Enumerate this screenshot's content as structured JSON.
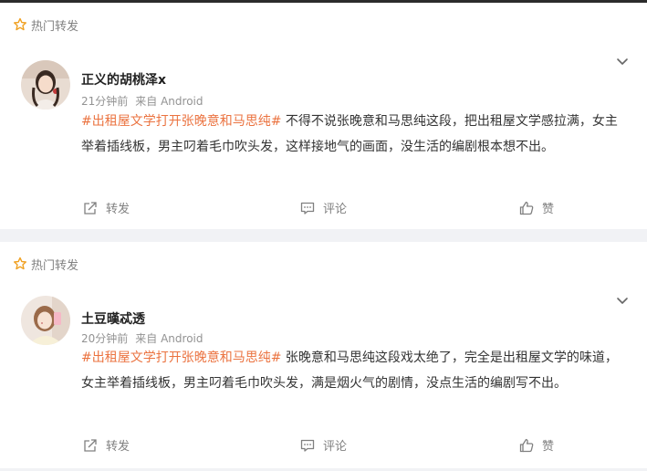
{
  "posts": [
    {
      "hot_label": "热门转发",
      "username": "正义的胡桃泽x",
      "time": "21分钟前",
      "source": "来自 Android",
      "hashtag": "#出租屋文学打开张晚意和马思纯#",
      "text": " 不得不说张晚意和马思纯这段，把出租屋文学感拉满，女主举着插线板，男主叼着毛巾吹头发，这样接地气的画面，没生活的编剧根本想不出。",
      "actions": {
        "forward": "转发",
        "comment": "评论",
        "like": "赞"
      }
    },
    {
      "hot_label": "热门转发",
      "username": "土豆暵忒透",
      "time": "20分钟前",
      "source": "来自 Android",
      "hashtag": "#出租屋文学打开张晚意和马思纯#",
      "text": " 张晚意和马思纯这段戏太绝了，完全是出租屋文学的味道，女主举着插线板，男主叼着毛巾吹头发，满是烟火气的剧情，没点生活的编剧写不出。",
      "actions": {
        "forward": "转发",
        "comment": "评论",
        "like": "赞"
      }
    }
  ],
  "colors": {
    "accent": "#eb7340",
    "star": "#f0a020",
    "meta": "#939393"
  },
  "icons": [
    "star-icon",
    "chevron-down-icon",
    "forward-icon",
    "comment-icon",
    "like-icon"
  ]
}
